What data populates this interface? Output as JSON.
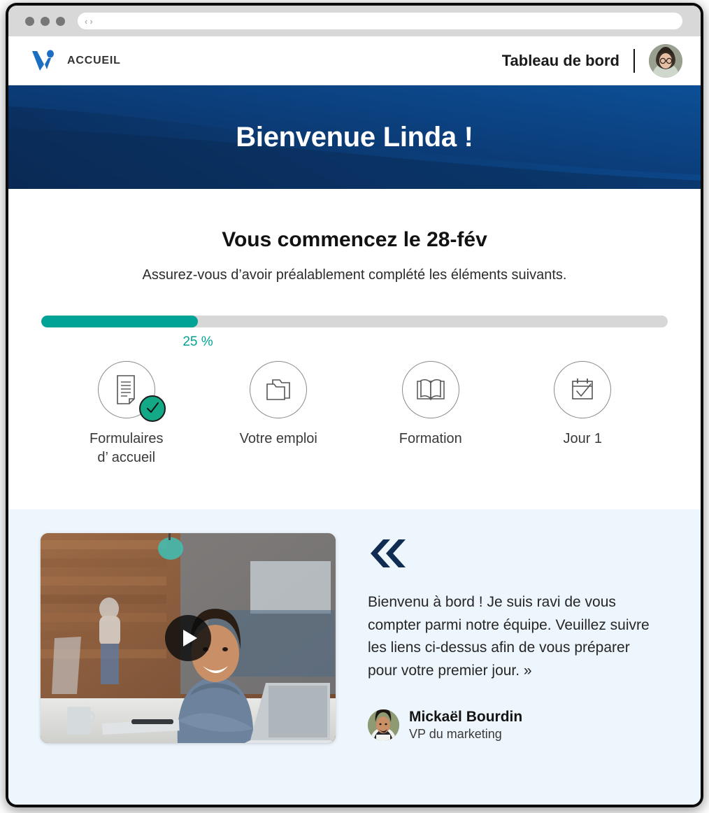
{
  "browser": {
    "back_label": "‹",
    "forward_label": "›",
    "url_value": ""
  },
  "header": {
    "logo_name": "v-logo-icon",
    "brand_label": "ACCUEIL",
    "title": "Tableau de bord",
    "avatar_name": "user-avatar"
  },
  "hero": {
    "welcome_title": "Bienvenue Linda !",
    "gradient_from": "#0a2c59",
    "gradient_to": "#0b4b90"
  },
  "start": {
    "heading": "Vous commencez le 28-fév",
    "subheading": "Assurez-vous d’avoir préalablement complété les éléments suivants.",
    "progress_percent": 25,
    "progress_label": "25 %",
    "progress_color": "#00a396",
    "progress_track_color": "#d7d7d7"
  },
  "steps": [
    {
      "label": "Formulaires\nd’ accueil",
      "icon": "document-icon",
      "completed": true
    },
    {
      "label": "Votre emploi",
      "icon": "folders-icon",
      "completed": false
    },
    {
      "label": "Formation",
      "icon": "book-icon",
      "completed": false
    },
    {
      "label": "Jour 1",
      "icon": "calendar-check-icon",
      "completed": false
    }
  ],
  "welcome": {
    "video_name": "welcome-video-thumbnail",
    "play_label": "play-icon",
    "quote_icon": "double-chevron-quote-icon",
    "quote_text": "Bienvenu à bord ! Je suis ravi de vous compter parmi notre équipe. Veuillez suivre les liens ci-dessus afin de vous préparer pour votre premier jour. »",
    "author_name": "Mickaël Bourdin",
    "author_role": "VP du marketing",
    "background_color": "#edf5fd"
  }
}
